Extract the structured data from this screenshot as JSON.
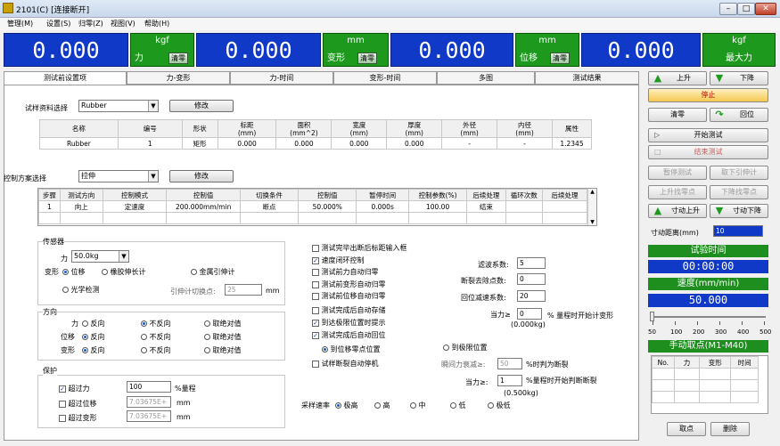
{
  "window": {
    "title": "2101(C)  [连接断开]"
  },
  "menu": [
    "管理(M)",
    "设置(S)",
    "归零(Z)",
    "视图(V)",
    "帮助(H)"
  ],
  "displays": [
    {
      "value": "0.000",
      "unit": "kgf",
      "label": "力",
      "clear": "清零"
    },
    {
      "value": "0.000",
      "unit": "mm",
      "label": "变形",
      "clear": "清零"
    },
    {
      "value": "0.000",
      "unit": "mm",
      "label": "位移",
      "clear": "清零"
    },
    {
      "value": "0.000",
      "unit": "kgf",
      "label": "最大力"
    }
  ],
  "tabs": [
    "测试前设置项",
    "力-变形",
    "力-时间",
    "变形-时间",
    "多图",
    "测试结果"
  ],
  "specimen": {
    "label": "试样资料选择",
    "value": "Rubber",
    "edit": "修改",
    "headers": [
      "名称",
      "编号",
      "形状",
      "标距\n(mm)",
      "面积\n(mm^2)",
      "宽度\n(mm)",
      "厚度\n(mm)",
      "外径\n(mm)",
      "内径\n(mm)",
      "属性"
    ],
    "row": [
      "Rubber",
      "1",
      "矩形",
      "0.000",
      "0.000",
      "0.000",
      "0.000",
      "-",
      "-",
      "1.2345"
    ]
  },
  "control": {
    "label": "控制方案选择",
    "value": "拉伸",
    "edit": "修改",
    "headers": [
      "步骤",
      "测试方向",
      "控制模式",
      "控制值",
      "切换条件",
      "控制值",
      "暂停时间",
      "控制参数(%)",
      "后续处理",
      "循环次数",
      "后续处理"
    ],
    "row": [
      "1",
      "向上",
      "定速度",
      "200.000mm/min",
      "断点",
      "50.000%",
      "0.000s",
      "100.00",
      "结束",
      "",
      ""
    ]
  },
  "sensor": {
    "title": "传感器",
    "force_label": "力",
    "force_value": "50.0kg",
    "deform_label": "变形",
    "opt_displacement": "位移",
    "opt_rubber": "橡胶伸长计",
    "opt_metal": "金属引伸计",
    "opt_optical": "光学检测",
    "switch_label": "引伸计切换点:",
    "switch_value": "25",
    "switch_unit": "mm"
  },
  "direction": {
    "title": "方向",
    "rows": [
      {
        "label": "力",
        "a": "反向",
        "b": "不反向",
        "c": "取绝对值"
      },
      {
        "label": "位移",
        "a": "反向",
        "b": "不反向",
        "c": "取绝对值"
      },
      {
        "label": "变形",
        "a": "反向",
        "b": "不反向",
        "c": "取绝对值"
      }
    ]
  },
  "protect": {
    "title": "保护",
    "over_force": "超过力",
    "over_force_value": "100",
    "over_force_unit": "%量程",
    "over_disp": "超过位移",
    "over_disp_value": "7.03675E+",
    "over_disp_unit": "mm",
    "over_deform": "超过变形",
    "over_deform_value": "7.03675E+",
    "over_deform_unit": "mm"
  },
  "options": {
    "checks": [
      "测试完毕出断后标距输入框",
      "速度闭环控制",
      "测试前力自动归零",
      "测试前变形自动归零",
      "测试前位移自动归零",
      "测试完成后自动存储",
      "到达极限位置时提示",
      "测试完成后自动回位"
    ],
    "return_zero": "到位移零点位置",
    "return_limit": "到极限位置",
    "stop_on_break": "试样断裂自动停机",
    "filter_label": "滤波系数:",
    "filter_value": "5",
    "break_label": "断裂去除点数:",
    "break_value": "0",
    "return_coef_label": "回位减速系数:",
    "return_coef_value": "20",
    "force_ge": "当力≥",
    "force_ge_value": "0",
    "force_ge_text": "% 量程时开始计变形",
    "force_ge_kg": "(0.000kg)",
    "decay_label": "瞬间力衰减≥:",
    "decay_value": "50",
    "decay_text": "%时判为断裂",
    "force_ge2": "当力≥:",
    "force_ge2_value": "1",
    "force_ge2_text": "%量程时开始判断断裂",
    "force_ge2_kg": "(0.500kg)",
    "rate_label": "采样速率",
    "rates": [
      "极高",
      "高",
      "中",
      "低",
      "极低"
    ]
  },
  "right": {
    "up": "上升",
    "down": "下降",
    "stop": "停止",
    "zero": "清零",
    "home": "回位",
    "start": "开始测试",
    "end": "结束测试",
    "pause": "暂停测试",
    "extens": "取下引伸计",
    "up_zero": "上升找零点",
    "down_zero": "下降找零点",
    "jog_up": "寸动上升",
    "jog_down": "寸动下降",
    "jog_dist_label": "寸动距离(mm)",
    "jog_dist": "10",
    "time_title": "试验时间",
    "time_value": "00:00:00",
    "speed_title": "速度(mm/min)",
    "speed_value": "50.000",
    "slider_ticks": [
      "50",
      "100",
      "200",
      "300",
      "400",
      "500"
    ],
    "manual_title": "手动取点(M1-M40)",
    "manual_headers": [
      "No.",
      "力",
      "变形",
      "时间"
    ],
    "pick": "取点",
    "delete": "删除"
  }
}
